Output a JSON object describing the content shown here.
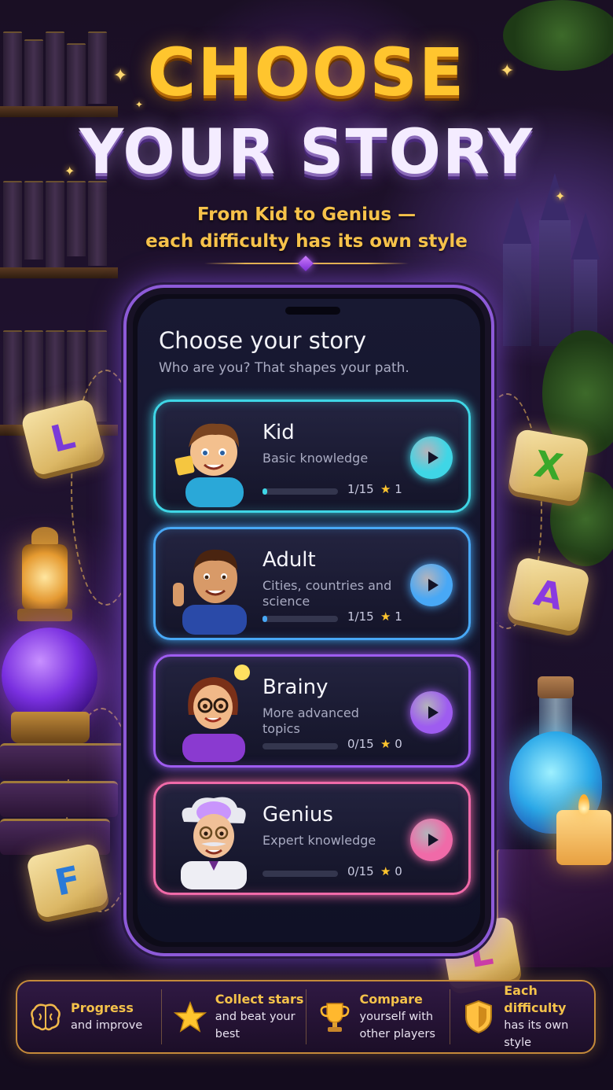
{
  "headline": {
    "line1": "CHOOSE",
    "line2": "YOUR STORY",
    "subtitle_line1": "From Kid to Genius —",
    "subtitle_line2": "each difficulty has its own style"
  },
  "decor_tiles": [
    "L",
    "X",
    "A",
    "F",
    "L"
  ],
  "screen": {
    "title": "Choose your story",
    "subtitle": "Who are you? That shapes your path."
  },
  "levels": [
    {
      "name": "Kid",
      "description": "Basic knowledge",
      "progress_text": "1/15",
      "progress_fraction": 0.067,
      "stars": "1",
      "accent": "#3fd6e6",
      "avatar": "kid-avatar"
    },
    {
      "name": "Adult",
      "description": "Cities, countries and science",
      "progress_text": "1/15",
      "progress_fraction": 0.067,
      "stars": "1",
      "accent": "#48a8f6",
      "avatar": "adult-avatar"
    },
    {
      "name": "Brainy",
      "description": "More advanced topics",
      "progress_text": "0/15",
      "progress_fraction": 0,
      "stars": "0",
      "accent": "#9e5cf0",
      "avatar": "brainy-avatar"
    },
    {
      "name": "Genius",
      "description": "Expert knowledge",
      "progress_text": "0/15",
      "progress_fraction": 0,
      "stars": "0",
      "accent": "#f06aa8",
      "avatar": "genius-avatar"
    }
  ],
  "features": [
    {
      "icon": "brain-icon",
      "title": "Progress",
      "text": "and improve"
    },
    {
      "icon": "star-icon",
      "title": "Collect stars",
      "text": "and beat your best"
    },
    {
      "icon": "trophy-icon",
      "title": "Compare",
      "text": "yourself with other players"
    },
    {
      "icon": "shield-icon",
      "title": "Each difficulty",
      "text": "has its own style"
    }
  ]
}
